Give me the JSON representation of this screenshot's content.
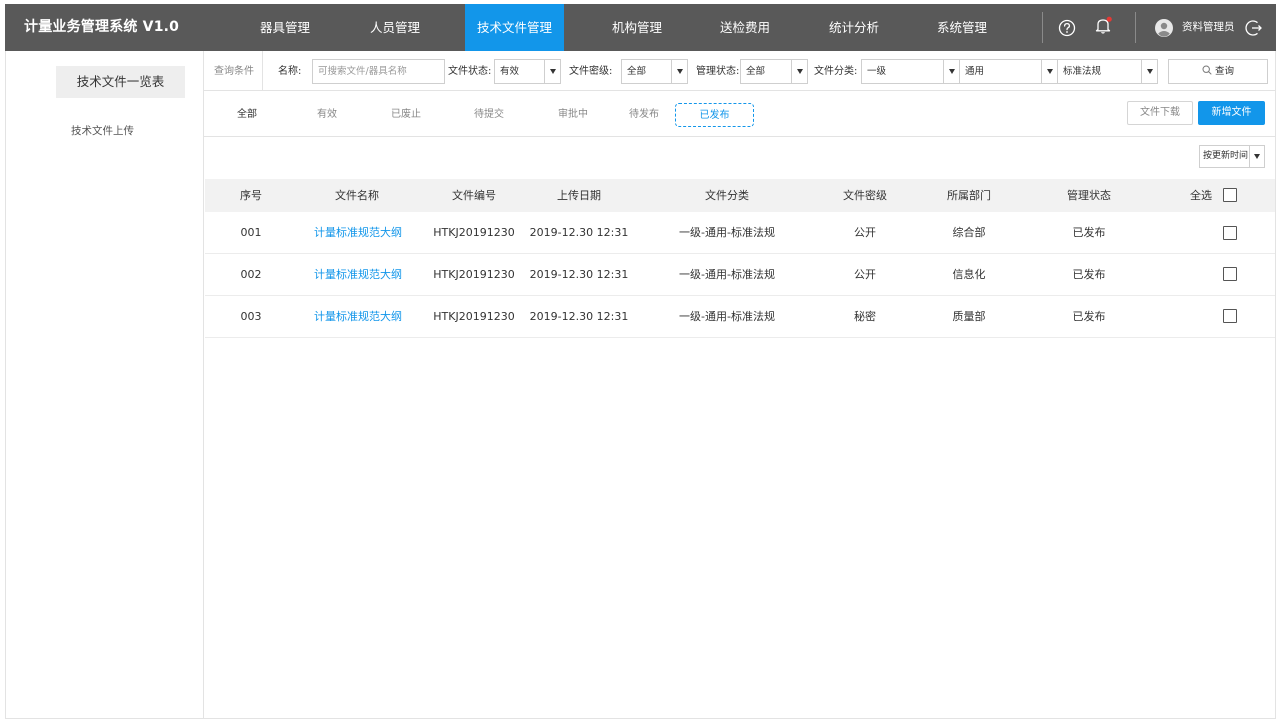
{
  "app": {
    "title": "计量业务管理系统 V1.0"
  },
  "nav": {
    "items": [
      {
        "label": "器具管理",
        "active": false
      },
      {
        "label": "人员管理",
        "active": false
      },
      {
        "label": "技术文件管理",
        "active": true
      },
      {
        "label": "机构管理",
        "active": false
      },
      {
        "label": "送检费用",
        "active": false
      },
      {
        "label": "统计分析",
        "active": false
      },
      {
        "label": "系统管理",
        "active": false
      }
    ],
    "user_name": "资料管理员",
    "accent_color": "#1296ea",
    "notification_dot_color": "#e53935",
    "icons": [
      "help-icon",
      "bell-icon",
      "avatar-icon",
      "logout-icon"
    ]
  },
  "sidebar": {
    "items": [
      {
        "label": "技术文件一览表",
        "active": true
      },
      {
        "label": "技术文件上传",
        "active": false
      }
    ]
  },
  "filters": {
    "section_label": "查询条件",
    "name_label": "名称:",
    "name_placeholder": "可搜索文件/器具名称",
    "status_label": "文件状态:",
    "status_value": "有效",
    "secrecy_label": "文件密级:",
    "secrecy_value": "全部",
    "mgmt_label": "管理状态:",
    "mgmt_value": "全部",
    "category_label": "文件分类:",
    "category_values": [
      "一级",
      "通用",
      "标准法规"
    ],
    "search_label": "查询"
  },
  "status_tabs": {
    "tabs": [
      "全部",
      "有效",
      "已废止",
      "待提交",
      "审批中",
      "待发布",
      "已发布"
    ],
    "active_index": 6,
    "download_label": "文件下载",
    "add_label": "新增文件"
  },
  "sort": {
    "value": "按更新时间"
  },
  "table": {
    "headers": [
      "序号",
      "文件名称",
      "文件编号",
      "上传日期",
      "文件分类",
      "文件密级",
      "所属部门",
      "管理状态",
      "全选"
    ],
    "rows": [
      {
        "no": "001",
        "name": "计量标准规范大纲",
        "code": "HTKJ20191230",
        "date": "2019-12.30 12:31",
        "category": "一级-通用-标准法规",
        "secrecy": "公开",
        "dept": "综合部",
        "status": "已发布"
      },
      {
        "no": "002",
        "name": "计量标准规范大纲",
        "code": "HTKJ20191230",
        "date": "2019-12.30 12:31",
        "category": "一级-通用-标准法规",
        "secrecy": "公开",
        "dept": "信息化",
        "status": "已发布"
      },
      {
        "no": "003",
        "name": "计量标准规范大纲",
        "code": "HTKJ20191230",
        "date": "2019-12.30 12:31",
        "category": "一级-通用-标准法规",
        "secrecy": "秘密",
        "dept": "质量部",
        "status": "已发布"
      }
    ]
  }
}
